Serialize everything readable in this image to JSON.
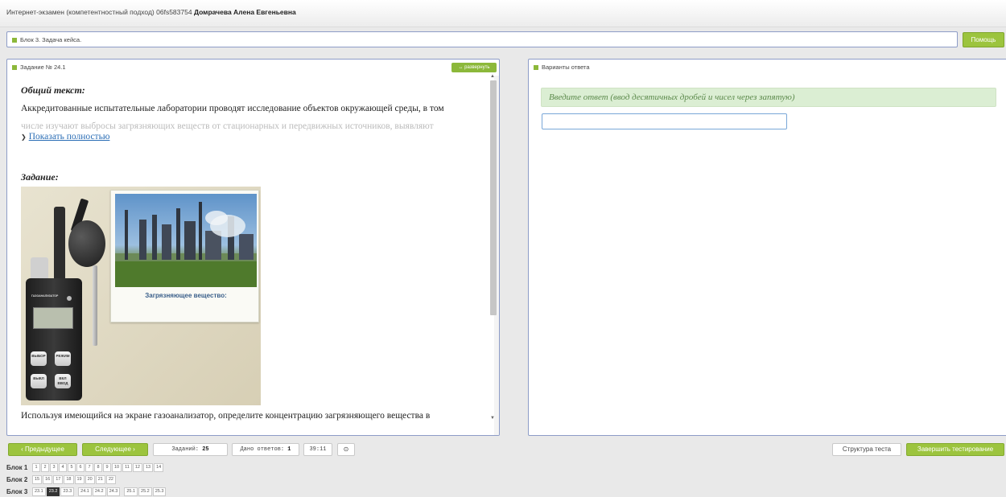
{
  "header": {
    "exam_title": "Интернет-экзамен (компетентностный подход) 06fs583754",
    "user_name": "Домрачева Алена Евгеньевна"
  },
  "block_bar": {
    "label": "Блок 3. Задача кейса."
  },
  "help_button": {
    "label": "Помощь"
  },
  "task_panel": {
    "title": "Задание № 24.1",
    "expand_label": "↔ развернуть",
    "general_label": "Общий текст:",
    "general_text_line1": "Аккредитованные испытательные лаборатории проводят исследование объектов окружающей среды, в том",
    "general_text_line2": "числе изучают выбросы загрязняющих веществ от стационарных и передвижных источников, выявляют",
    "show_more": "Показать полностью",
    "task_label": "Задание:",
    "image_caption": "Загрязняющее вещество:",
    "device_label": "ГАЗОАНАЛИЗАТОР",
    "device_buttons": [
      "ВЫБОР",
      "РЕЖИМ",
      "ВЫКЛ",
      "ВКЛ ВВОД"
    ],
    "task_text": "Используя имеющийся на экране газоанализатор, определите концентрацию загрязняющего вещества в"
  },
  "answer_panel": {
    "title": "Варианты ответа",
    "hint": "Введите ответ (ввод десятичных дробей и чисел через запятую)",
    "input_value": ""
  },
  "footer": {
    "prev_label": "‹ Предыдущее",
    "next_label": "Следующее ›",
    "tasks_label": "Заданий:",
    "tasks_count": "25",
    "answers_label": "Дано ответов:",
    "answers_count": "1",
    "timer": "39:11",
    "structure_label": "Структура теста",
    "finish_label": "Завершить тестирование"
  },
  "blocks": [
    {
      "name": "Блок 1",
      "questions": [
        "1",
        "2",
        "3",
        "4",
        "5",
        "6",
        "7",
        "8",
        "9",
        "10",
        "11",
        "12",
        "13",
        "14"
      ]
    },
    {
      "name": "Блок 2",
      "questions": [
        "15",
        "16",
        "17",
        "18",
        "19",
        "20",
        "21",
        "22"
      ]
    },
    {
      "name": "Блок 3",
      "questions": [
        "23.1",
        "23.2",
        "23.3",
        "24.1",
        "24.2",
        "24.3",
        "25.1",
        "25.2",
        "25.3"
      ],
      "active": "23.2"
    }
  ],
  "colors": {
    "accent": "#9cc43e",
    "panel_border": "#8d9cc7",
    "hint_bg": "#dbeed3"
  }
}
